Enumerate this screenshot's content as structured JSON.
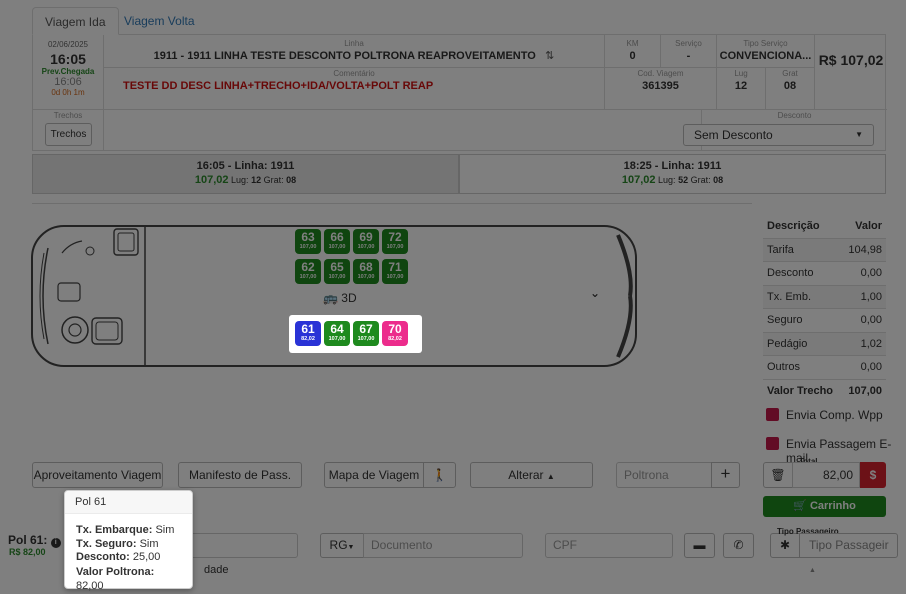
{
  "tabs": [
    {
      "label": "Viagem Ida",
      "active": true
    },
    {
      "label": "Viagem Volta",
      "active": false
    }
  ],
  "header": {
    "date": "02/06/2025",
    "time": "16:05",
    "prev_label": "Prev.Chegada",
    "prev_time": "16:06",
    "duration": "0d 0h 1m",
    "linha_label": "Linha",
    "linha_value": "1911 - 1911 LINHA TESTE DESCONTO POLTRONA REAPROVEITAMENTO",
    "comentario_label": "Comentário",
    "comentario_value": "TESTE DD DESC LINHA+TRECHO+IDA/VOLTA+POLT REAP",
    "km_label": "KM",
    "km_value": "0",
    "servico_label": "Serviço",
    "servico_value": "-",
    "tipo_servico_label": "Tipo Serviço",
    "tipo_servico_value": "CONVENCIONA...",
    "price": "R$ 107,02",
    "cod_viagem_label": "Cod. Viagem",
    "cod_viagem_value": "361395",
    "lug_label": "Lug",
    "lug_value": "12",
    "grat_label": "Grat",
    "grat_value": "08",
    "trechos_label": "Trechos",
    "trechos_button": "Trechos",
    "desconto_label": "Desconto",
    "desconto_value": "Sem Desconto"
  },
  "trips": [
    {
      "title": "16:05 - Linha: 1911",
      "price": "107,02",
      "lug_label": "Lug:",
      "lug": "12",
      "grat_label": "Grat:",
      "grat": "08",
      "selected": true
    },
    {
      "title": "18:25 - Linha: 1911",
      "price": "107,02",
      "lug_label": "Lug:",
      "lug": "52",
      "grat_label": "Grat:",
      "grat": "08",
      "selected": false
    }
  ],
  "seats_top": [
    [
      {
        "n": "63",
        "p": "107,00"
      },
      {
        "n": "66",
        "p": "107,00"
      },
      {
        "n": "69",
        "p": "107,00"
      },
      {
        "n": "72",
        "p": "107,00"
      }
    ],
    [
      {
        "n": "62",
        "p": "107,00"
      },
      {
        "n": "65",
        "p": "107,00"
      },
      {
        "n": "68",
        "p": "107,00"
      },
      {
        "n": "71",
        "p": "107,00"
      }
    ]
  ],
  "seats_bottom": [
    {
      "n": "61",
      "p": "82,02",
      "color": "#2a33d6"
    },
    {
      "n": "64",
      "p": "107,00",
      "color": "#1e8a1e"
    },
    {
      "n": "67",
      "p": "107,00",
      "color": "#1e8a1e"
    },
    {
      "n": "70",
      "p": "82,02",
      "color": "#ec2c8c"
    }
  ],
  "bus_3d_label": "3D",
  "price_table": {
    "head_desc": "Descrição",
    "head_val": "Valor",
    "rows": [
      {
        "k": "Tarifa",
        "v": "104,98"
      },
      {
        "k": "Desconto",
        "v": "0,00"
      },
      {
        "k": "Tx. Emb.",
        "v": "1,00"
      },
      {
        "k": "Seguro",
        "v": "0,00"
      },
      {
        "k": "Pedágio",
        "v": "1,02"
      },
      {
        "k": "Outros",
        "v": "0,00"
      }
    ],
    "total_k": "Valor Trecho",
    "total_v": "107,00"
  },
  "envia_wpp": "Envia Comp. Wpp",
  "envia_email": "Envia Passagem E-mail",
  "buttons": {
    "aproveitamento": "Aproveitamento Viagem",
    "manifesto": "Manifesto de Pass.",
    "mapa": "Mapa de Viagem",
    "alterar": "Alterar",
    "carrinho": "Carrinho"
  },
  "poltrona_placeholder": "Poltrona",
  "total_label": "Total",
  "total_value": "82,00",
  "pol_label": "Pol 61:",
  "pol_price": "R$ 82,00",
  "rg_label": "RG",
  "documento_placeholder": "Documento",
  "cpf_placeholder": "CPF",
  "tipo_passageiro_label": "Tipo Passageiro",
  "tipo_passageiro_value": "Tipo Passageir",
  "dade_text": "dade",
  "popover": {
    "title": "Pol 61",
    "l1k": "Tx. Embarque:",
    "l1v": "Sim",
    "l2k": "Tx. Seguro:",
    "l2v": "Sim",
    "l3k": "Desconto:",
    "l3v": "25,00",
    "l4k": "Valor Poltrona:",
    "l4v": "82,00"
  }
}
